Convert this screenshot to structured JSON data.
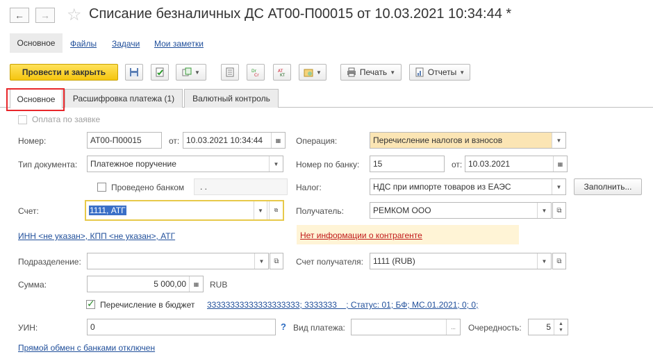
{
  "window": {
    "title": "Списание безналичных ДС АТ00-П00015 от 10.03.2021 10:34:44 *"
  },
  "sections": {
    "main": "Основное",
    "files": "Файлы",
    "tasks": "Задачи",
    "notes": "Мои заметки"
  },
  "toolbar": {
    "post_and_close": "Провести и закрыть",
    "print": "Печать",
    "reports": "Отчеты"
  },
  "tabs": [
    {
      "label": "Основное"
    },
    {
      "label": "Расшифровка платежа (1)"
    },
    {
      "label": "Валютный контроль"
    }
  ],
  "form": {
    "pay_by_request": "Оплата по заявке",
    "number_label": "Номер:",
    "number_value": "АТ00-П00015",
    "from_label": "от:",
    "date_value": "10.03.2021 10:34:44",
    "operation_label": "Операция:",
    "operation_value": "Перечисление налогов и взносов",
    "doc_type_label": "Тип документа:",
    "doc_type_value": "Платежное поручение",
    "bank_number_label": "Номер по банку:",
    "bank_number_value": "15",
    "bank_from_label": "от:",
    "bank_date_value": "10.03.2021",
    "posted_by_bank": "Проведено банком",
    "posted_date": ". .",
    "tax_label": "Налог:",
    "tax_value": "НДС при импорте товаров из ЕАЭС",
    "fill_button": "Заполнить...",
    "account_label": "Счет:",
    "account_value": "1111, АТГ",
    "recipient_label": "Получатель:",
    "recipient_value": "РЕМКОМ ООО",
    "inn_link": "ИНН <не указан>, КПП <не указан>, АТГ",
    "no_info_link": "Нет информации о контрагенте",
    "department_label": "Подразделение:",
    "department_value": "",
    "recipient_account_label": "Счет получателя:",
    "recipient_account_value": "1111 (RUB)",
    "sum_label": "Сумма:",
    "sum_value": "5 000,00",
    "currency": "RUB",
    "budget_transfer": "Перечисление в бюджет",
    "budget_details_link": "33333333333333333333; 3333333    ; Статус: 01; БФ; МС.01.2021; 0; 0;",
    "uin_label": "УИН:",
    "uin_value": "0",
    "help_mark": "?",
    "payment_type_label": "Вид платежа:",
    "payment_type_value": "",
    "priority_label": "Очередность:",
    "priority_value": "5",
    "bank_exchange_link": "Прямой обмен с банками отключен"
  }
}
